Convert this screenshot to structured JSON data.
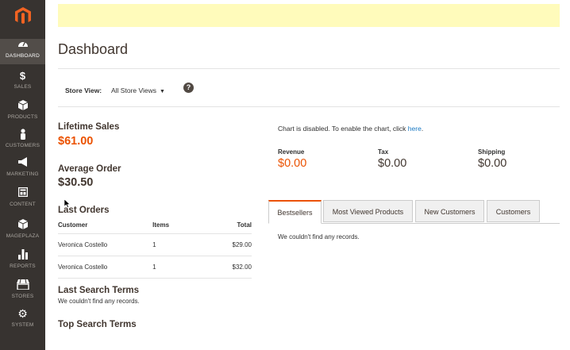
{
  "sidebar": {
    "items": [
      {
        "label": "DASHBOARD",
        "icon": "speedometer-icon"
      },
      {
        "label": "SALES",
        "icon": "dollar-icon"
      },
      {
        "label": "PRODUCTS",
        "icon": "cube-icon"
      },
      {
        "label": "CUSTOMERS",
        "icon": "person-icon"
      },
      {
        "label": "MARKETING",
        "icon": "megaphone-icon"
      },
      {
        "label": "CONTENT",
        "icon": "layout-icon"
      },
      {
        "label": "MAGEPLAZA",
        "icon": "mageplaza-icon"
      },
      {
        "label": "REPORTS",
        "icon": "bar-chart-icon"
      },
      {
        "label": "STORES",
        "icon": "store-icon"
      },
      {
        "label": "SYSTEM",
        "icon": "gear-icon"
      }
    ]
  },
  "header": {
    "title": "Dashboard"
  },
  "store_switcher": {
    "label": "Store View:",
    "value": "All Store Views",
    "help": "?"
  },
  "lifetime_sales": {
    "label": "Lifetime Sales",
    "value": "$61.00"
  },
  "average_order": {
    "label": "Average Order",
    "value": "$30.50"
  },
  "last_orders": {
    "title": "Last Orders",
    "columns": [
      "Customer",
      "Items",
      "Total"
    ],
    "rows": [
      {
        "customer": "Veronica Costello",
        "items": "1",
        "total": "$29.00"
      },
      {
        "customer": "Veronica Costello",
        "items": "1",
        "total": "$32.00"
      }
    ]
  },
  "last_search_terms": {
    "title": "Last Search Terms",
    "message": "We couldn't find any records."
  },
  "top_search_terms": {
    "title": "Top Search Terms"
  },
  "chart": {
    "message": "Chart is disabled. To enable the chart, click ",
    "link": "here",
    "suffix": "."
  },
  "totals": {
    "revenue": {
      "label": "Revenue",
      "value": "$0.00"
    },
    "tax": {
      "label": "Tax",
      "value": "$0.00"
    },
    "shipping": {
      "label": "Shipping",
      "value": "$0.00"
    }
  },
  "tabs": {
    "items": [
      "Bestsellers",
      "Most Viewed Products",
      "New Customers",
      "Customers"
    ],
    "active": "Bestsellers",
    "message": "We couldn't find any records."
  },
  "colors": {
    "accent": "#eb5202",
    "sidebar": "#373330",
    "notice": "#fffbbb",
    "link": "#1979c3"
  }
}
